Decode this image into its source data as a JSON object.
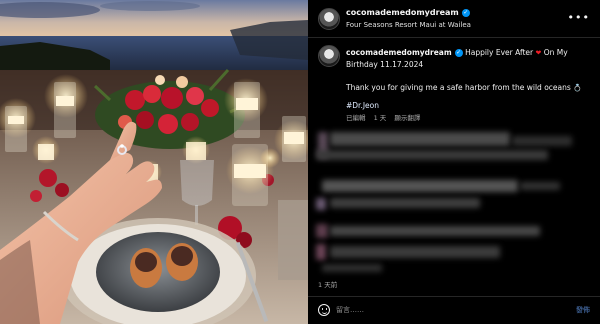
{
  "post": {
    "username": "cocomademedomydream",
    "verified_badge": "✓",
    "location": "Four Seasons Resort Maui at Wailea",
    "more_icon": "more-horizontal-icon"
  },
  "caption": {
    "username": "cocomademedomydream",
    "line1": "Happily Ever After",
    "line1_tail": "On My Birthday 11.17.2024",
    "heart": "❤",
    "line2": "Thank you for giving me a safe harbor from the wild oceans",
    "ring": "💍",
    "tag": "#Dr.Jeon",
    "meta_edited": "已編輯",
    "meta_time": "1 天",
    "meta_translate": "顯示翻譯"
  },
  "footer": {
    "time_ago": "1 天前",
    "comment_placeholder": "留言……",
    "post_label": "發佈"
  },
  "colors": {
    "verified": "#0095f6",
    "heart": "#ed1c24",
    "background": "#000000"
  }
}
